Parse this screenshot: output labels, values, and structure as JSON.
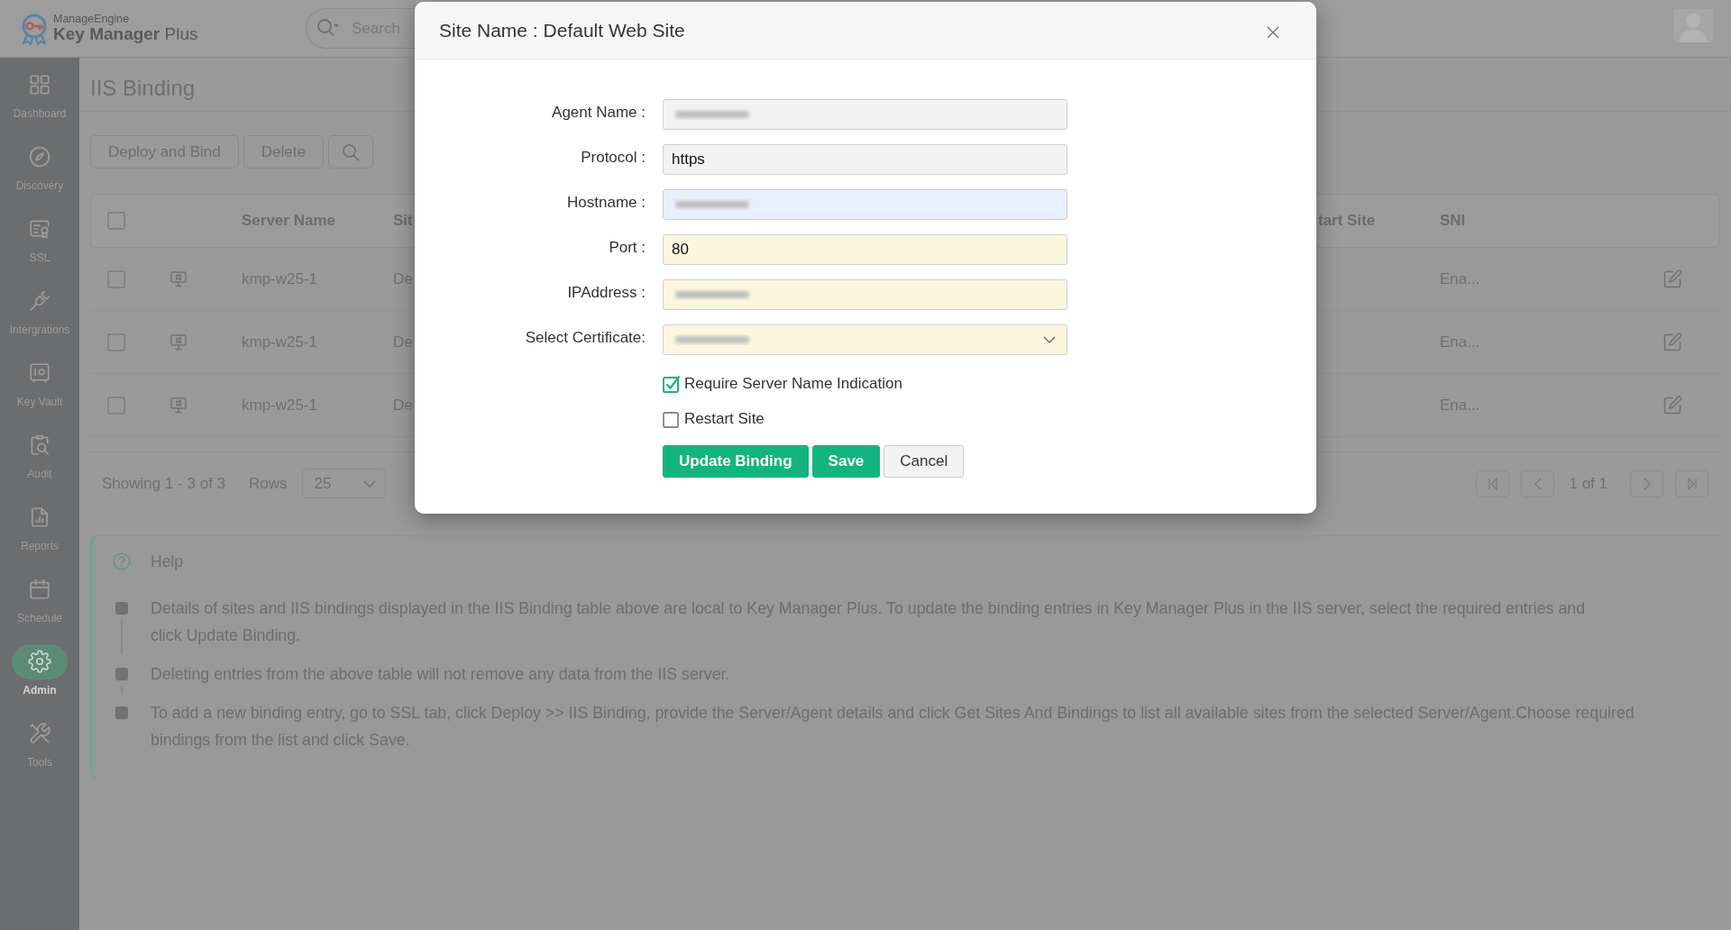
{
  "header": {
    "brand_small": "ManageEngine",
    "brand": "**Key Manager** Plus",
    "search": {
      "placeholder": "Search"
    }
  },
  "sidebar": {
    "items": [
      {
        "label": "Dashboard",
        "selected": false
      },
      {
        "label": "Discovery",
        "selected": false
      },
      {
        "label": "SSL",
        "selected": false
      },
      {
        "label": "Intergrations",
        "selected": false
      },
      {
        "label": "Key Vault",
        "selected": false
      },
      {
        "label": "Audit",
        "selected": false
      },
      {
        "label": "Reports",
        "selected": false
      },
      {
        "label": "Schedule",
        "selected": false
      },
      {
        "label": "Admin",
        "selected": true
      },
      {
        "label": "Tools",
        "selected": false
      }
    ]
  },
  "page": {
    "title": "IIS Binding",
    "toolbar": [
      "Deploy and Bind",
      "Delete"
    ]
  },
  "table": {
    "select_all": {
      "checked": false
    },
    "columns": [
      "Server Name",
      "Sit",
      "tart Site",
      "SNI"
    ],
    "rows": [
      {
        "checked": false,
        "server_name": "kmp-w25-1",
        "column_3": "De",
        "sni": "Ena..."
      },
      {
        "checked": false,
        "server_name": "kmp-w25-1",
        "column_3": "De",
        "sni": "Ena..."
      },
      {
        "checked": false,
        "server_name": "kmp-w25-1",
        "column_3": "De",
        "sni": "Ena..."
      }
    ]
  },
  "footer": {
    "showing": "Showing 1 - 3 of 3",
    "rows_label": "Rows",
    "rows_value": "25",
    "page": "1 of 1"
  },
  "help": {
    "title": "Help",
    "items": [
      "Details of sites and IIS bindings displayed in the IIS Binding table above are local to Key Manager Plus. To update the binding entries in Key Manager Plus in the IIS server, select the required entries and\nclick Update Binding.",
      "Deleting entries from the above table will not remove any data from the IIS server.",
      "To add a new binding entry, go to SSL tab, click Deploy >> IIS Binding, provide the Server/Agent details and click Get Sites And Bindings to list all available sites from the selected Server/Agent.Choose required bindings from the list and click Save."
    ]
  },
  "dialog": {
    "title": "Site Name : Default Web Site",
    "fields": [
      {
        "label": "Agent Name :",
        "kind": "text",
        "redacted": true,
        "color": "#f2f2f2"
      },
      {
        "label": "Protocol :",
        "kind": "text",
        "value": "https",
        "redacted": false,
        "color": "#f2f2f2"
      },
      {
        "label": "Hostname :",
        "kind": "text",
        "redacted": true,
        "color": "#e8f0fe"
      },
      {
        "label": "Port :",
        "kind": "text",
        "value": "80",
        "redacted": false,
        "color": "#fcf6df"
      },
      {
        "label": "IPAddress :",
        "kind": "text",
        "redacted": true,
        "color": "#fcf6df"
      },
      {
        "label": "Select Certificate:",
        "kind": "select",
        "redacted": true,
        "color": "#fcf6df"
      }
    ],
    "checkboxes": [
      {
        "label": "Require Server Name Indication",
        "checked": true
      },
      {
        "label": "Restart Site",
        "checked": false
      }
    ],
    "buttons": [
      {
        "label": "Update Binding",
        "kind": "primary"
      },
      {
        "label": "Save",
        "kind": "primary"
      },
      {
        "label": "Cancel",
        "kind": "secondary"
      }
    ]
  }
}
